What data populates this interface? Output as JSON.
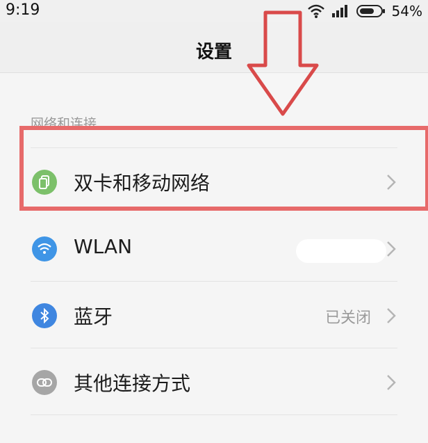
{
  "status_bar": {
    "time": "9:19",
    "battery_percent": "54%",
    "icons": [
      "wifi-icon",
      "signal-icon",
      "battery-icon"
    ]
  },
  "header": {
    "title": "设置"
  },
  "section": {
    "header": "网络和连接"
  },
  "items": [
    {
      "label": "双卡和移动网络",
      "value": "",
      "icon": "sim-card-icon",
      "icon_color": "#7cc06a"
    },
    {
      "label": "WLAN",
      "value": "",
      "icon": "wifi-icon",
      "icon_color": "#3f95e6"
    },
    {
      "label": "蓝牙",
      "value": "已关闭",
      "icon": "bluetooth-icon",
      "icon_color": "#3f86e0"
    },
    {
      "label": "其他连接方式",
      "value": "",
      "icon": "link-icon",
      "icon_color": "#a6a6a6"
    }
  ],
  "annotation": {
    "box_color": "#e76a6a",
    "arrow_color": "#d94a4a"
  }
}
